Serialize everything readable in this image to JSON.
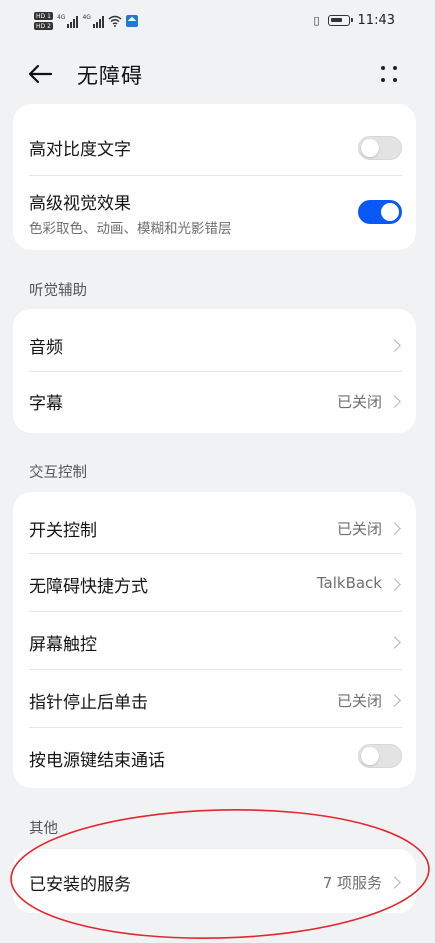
{
  "status_bar": {
    "network_1": "4G",
    "network_2": "4G",
    "time": "11:43",
    "hd_1": "HD",
    "hd_2": "HD",
    "sim_1": "1",
    "sim_2": "2"
  },
  "header": {
    "title": "无障碍"
  },
  "vision_card": {
    "high_contrast_text": {
      "label": "高对比度文字",
      "enabled": false
    },
    "advanced_visual_effects": {
      "label": "高级视觉效果",
      "subtitle": "色彩取色、动画、模糊和光影错层",
      "enabled": true
    }
  },
  "hearing_section": {
    "title": "听觉辅助",
    "items": [
      {
        "label": "音频",
        "value": ""
      },
      {
        "label": "字幕",
        "value": "已关闭"
      }
    ]
  },
  "interaction_section": {
    "title": "交互控制",
    "items": [
      {
        "label": "开关控制",
        "value": "已关闭"
      },
      {
        "label": "无障碍快捷方式",
        "value": "TalkBack"
      },
      {
        "label": "屏幕触控",
        "value": ""
      },
      {
        "label": "指针停止后单击",
        "value": "已关闭"
      }
    ],
    "power_end_call": {
      "label": "按电源键结束通话",
      "enabled": false
    }
  },
  "other_section": {
    "title": "其他",
    "items": [
      {
        "label": "已安装的服务",
        "value": "7 项服务"
      }
    ]
  },
  "colors": {
    "accent": "#0a59f7",
    "annotation": "#e0282e",
    "background": "#f1f2f4"
  }
}
